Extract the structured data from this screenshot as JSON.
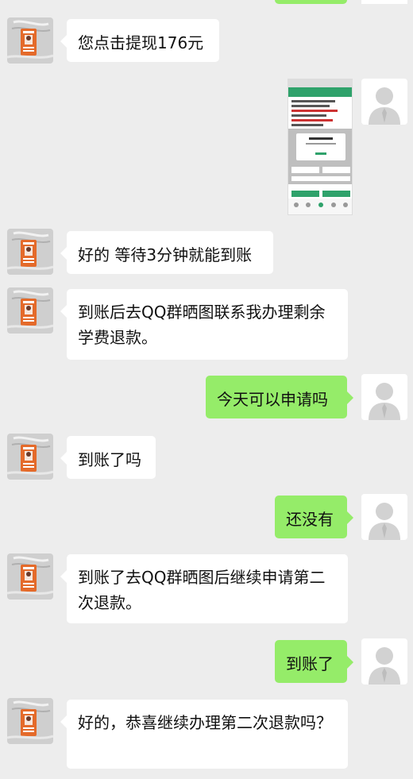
{
  "colors": {
    "background": "#ededed",
    "incoming_bubble": "#ffffff",
    "outgoing_bubble": "#95ec69"
  },
  "icons": {
    "incoming_avatar": "id-badge-photo-avatar",
    "outgoing_avatar": "default-person-avatar"
  },
  "messages": [
    {
      "side": "left",
      "text": "您点击提现176元"
    },
    {
      "side": "right",
      "type": "image"
    },
    {
      "side": "left",
      "text": "好的 等待3分钟就能到账"
    },
    {
      "side": "left",
      "text": "到账后去QQ群晒图联系我办理剩余学费退款。"
    },
    {
      "side": "right",
      "text": "今天可以申请吗"
    },
    {
      "side": "left",
      "text": "到账了吗"
    },
    {
      "side": "right",
      "text": "还没有"
    },
    {
      "side": "left",
      "text": "到账了去QQ群晒图后继续申请第二次退款。"
    },
    {
      "side": "right",
      "text": "到账了"
    },
    {
      "side": "left",
      "text": "好的，恭喜继续办理第二次退款吗？"
    }
  ]
}
